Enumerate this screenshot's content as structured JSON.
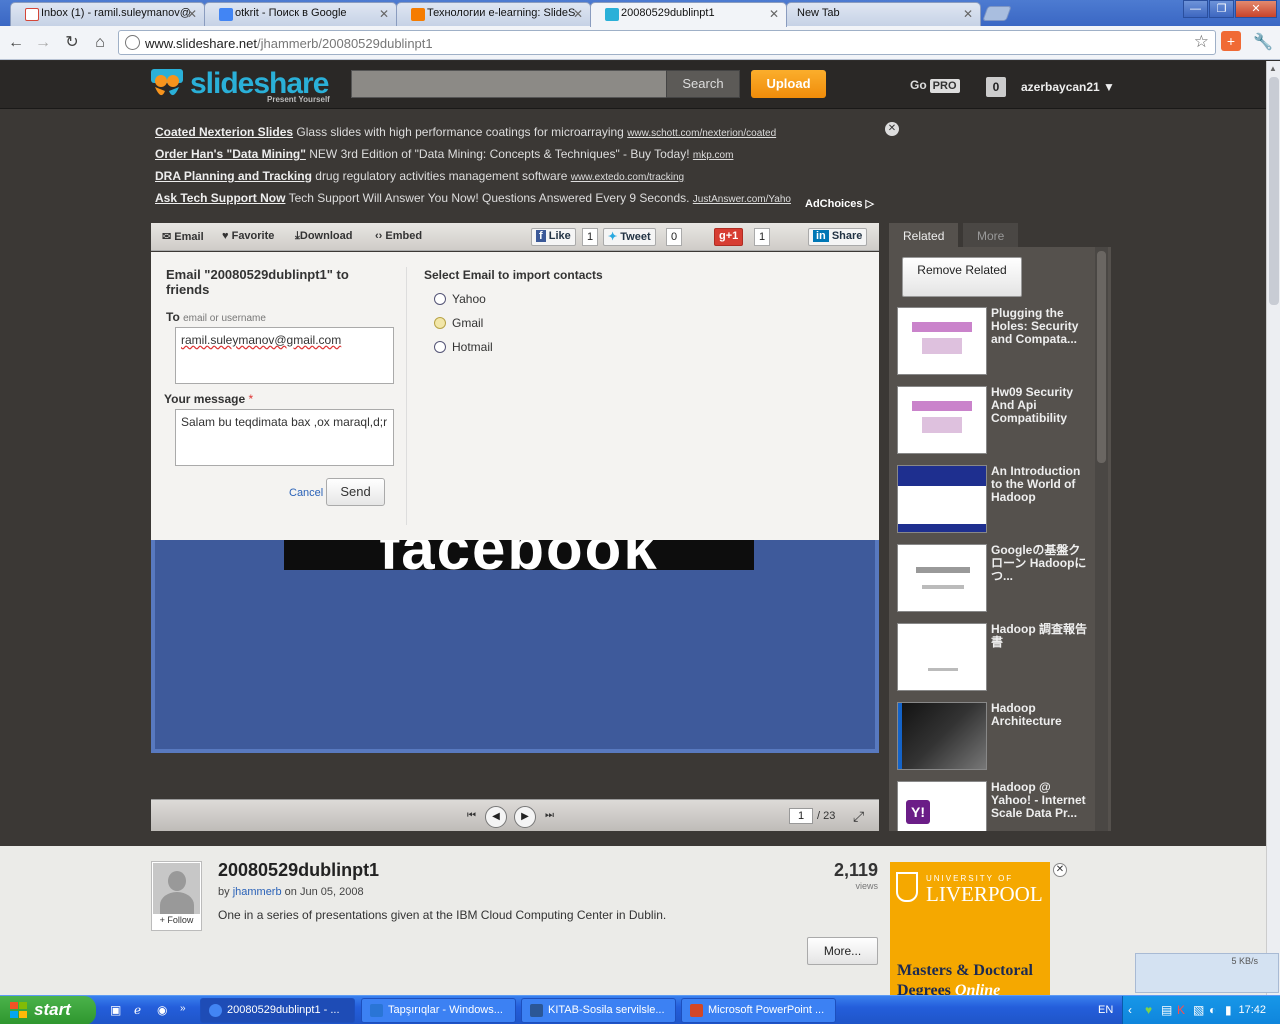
{
  "browser": {
    "tabs": [
      {
        "title": "Inbox (1) - ramil.suleymanov@",
        "color": "#d44638"
      },
      {
        "title": "otkrit - Поиск в Google",
        "color": "#4285f4"
      },
      {
        "title": "Технологии e-learning: SlideS",
        "color": "#f57c00"
      },
      {
        "title": "20080529dublinpt1",
        "color": "#2ab0d8"
      },
      {
        "title": "New Tab",
        "color": ""
      }
    ],
    "url_host": "www.slideshare.net",
    "url_path": "/jhammerb/20080529dublinpt1",
    "window_buttons": [
      "—",
      "❐",
      "✕"
    ]
  },
  "header": {
    "logo": "slideshare",
    "tagline": "Present Yourself",
    "search_label": "Search",
    "upload_label": "Upload",
    "go_label": "Go",
    "pro_label": "PRO",
    "notification_count": "0",
    "username": "azerbaycan21 ▼"
  },
  "ads": [
    {
      "title": "Coated Nexterion Slides",
      "text": "Glass slides with high performance coatings for microarraying",
      "url": "www.schott.com/nexterion/coated"
    },
    {
      "title": "Order Han's \"Data Mining\"",
      "text": "NEW 3rd Edition of \"Data Mining: Concepts & Techniques\" - Buy Today!",
      "url": "mkp.com"
    },
    {
      "title": "DRA Planning and Tracking",
      "text": "drug regulatory activities management software",
      "url": "www.extedo.com/tracking"
    },
    {
      "title": "Ask Tech Support Now",
      "text": "Tech Support Will Answer You Now! Questions Answered Every 9 Seconds.",
      "url": "JustAnswer.com/Yaho"
    }
  ],
  "adchoices": "AdChoices ▷",
  "player_toolbar": {
    "email": "Email",
    "favorite": "Favorite",
    "download": "Download",
    "embed": "Embed",
    "like": "Like",
    "like_count": "1",
    "tweet": "Tweet",
    "tweet_count": "0",
    "plusone": "+1",
    "plusone_count": "1",
    "share": "Share"
  },
  "email_panel": {
    "title": "Email \"20080529dublinpt1\" to friends",
    "to_label": "To",
    "to_hint": "email or username",
    "to_value": "ramil.suleymanov@gmail.com",
    "message_label": "Your message",
    "message_required": "*",
    "message_value": "Salam bu teqdimata bax ,ox maraql,d;r",
    "cancel": "Cancel",
    "send": "Send",
    "import_title": "Select Email to import contacts",
    "providers": [
      "Yahoo",
      "Gmail",
      "Hotmail"
    ]
  },
  "slide": {
    "visible_text": "facebook"
  },
  "controls": {
    "current_page": "1",
    "total_pages": "/ 23"
  },
  "related": {
    "tab_related": "Related",
    "tab_more": "More",
    "remove_label": "Remove Related",
    "items": [
      {
        "title": "Plugging the Holes: Security and Compata..."
      },
      {
        "title": "Hw09 Security And Api Compatibility"
      },
      {
        "title": "An Introduction to the World of Hadoop"
      },
      {
        "title": "Googleの基盤クローン Hadoopにつ..."
      },
      {
        "title": "Hadoop 調査報告書"
      },
      {
        "title": "Hadoop Architecture"
      },
      {
        "title": "Hadoop @ Yahoo! - Internet Scale Data Pr..."
      }
    ]
  },
  "info": {
    "title": "20080529dublinpt1",
    "by": "by",
    "author": "jhammerb",
    "on_date": "on Jun 05, 2008",
    "description": "One in a series of presentations given at the IBM Cloud Computing Center in Dublin.",
    "views_count": "2,119",
    "views_label": "views",
    "more_label": "More...",
    "follow_label": "+ Follow"
  },
  "liverpool_ad": {
    "university_of": "UNIVERSITY OF",
    "name": "LIVERPOOL",
    "line1": "Masters & Doctoral",
    "line2a": "Degrees",
    "line2b": "Online"
  },
  "netmeter": "5 KB/s",
  "taskbar": {
    "start": "start",
    "buttons": [
      {
        "label": "20080529dublinpt1 - ...",
        "color": "#4285f4"
      },
      {
        "label": "Tapşırıqlar - Windows...",
        "color": "#2a75d6"
      },
      {
        "label": "KITAB-Sosila servilsle...",
        "color": "#2b5797"
      },
      {
        "label": "Microsoft PowerPoint ...",
        "color": "#d24726"
      }
    ],
    "language": "EN",
    "time": "17:42"
  }
}
